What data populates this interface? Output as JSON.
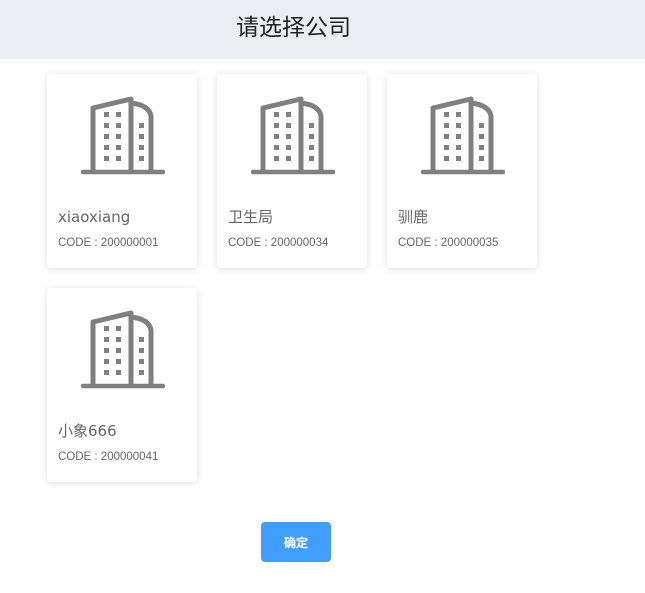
{
  "header": {
    "title": "请选择公司"
  },
  "companies": [
    {
      "name": "xiaoxiang",
      "code": "CODE : 200000001",
      "icon": "building-icon"
    },
    {
      "name": "卫生局",
      "code": "CODE : 200000034",
      "icon": "building-icon"
    },
    {
      "name": "驯鹿",
      "code": "CODE : 200000035",
      "icon": "building-icon"
    },
    {
      "name": "小象666",
      "code": "CODE : 200000041",
      "icon": "building-icon"
    }
  ],
  "actions": {
    "confirm_label": "确定"
  },
  "colors": {
    "header_bg": "#ebeef3",
    "primary": "#409eff",
    "icon": "#808080",
    "text": "#666666"
  }
}
